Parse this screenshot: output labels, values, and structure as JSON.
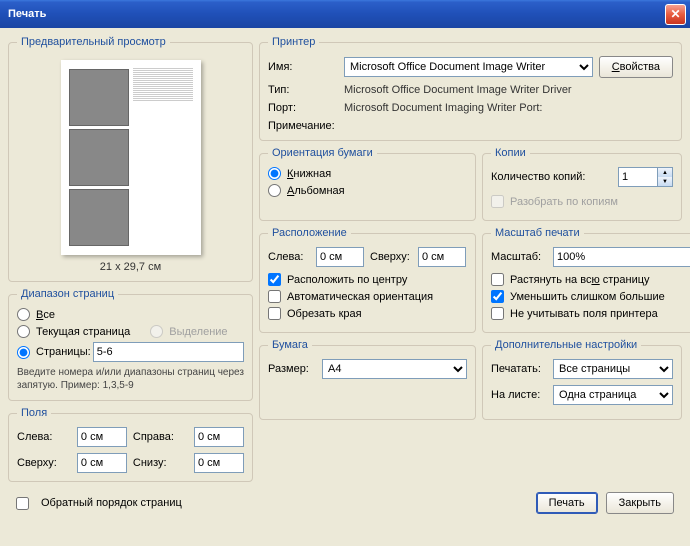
{
  "title": "Печать",
  "preview": {
    "legend": "Предварительный просмотр",
    "dimensions": "21 x 29,7 см"
  },
  "printer": {
    "legend": "Принтер",
    "name_label": "Имя:",
    "name_value": "Microsoft Office Document Image Writer",
    "props_btn": "Свойства",
    "type_label": "Тип:",
    "type_value": "Microsoft Office Document Image Writer Driver",
    "port_label": "Порт:",
    "port_value": "Microsoft Document Imaging Writer Port:",
    "note_label": "Примечание:",
    "note_value": ""
  },
  "orientation": {
    "legend": "Ориентация бумаги",
    "portrait": "Книжная",
    "landscape": "Альбомная"
  },
  "copies": {
    "legend": "Копии",
    "count_label": "Количество копий:",
    "count_value": "1",
    "collate": "Разобрать по копиям"
  },
  "range": {
    "legend": "Диапазон страниц",
    "all": "Все",
    "current": "Текущая страница",
    "selection": "Выделение",
    "pages": "Страницы:",
    "pages_value": "5-6",
    "hint": "Введите номера и/или диапазоны страниц через запятую. Пример: 1,3,5-9"
  },
  "layout": {
    "legend": "Расположение",
    "left_label": "Слева:",
    "left_value": "0 см",
    "top_label": "Сверху:",
    "top_value": "0 см",
    "center": "Расположить по центру",
    "auto_orient": "Автоматическая ориентация",
    "crop": "Обрезать края"
  },
  "scale": {
    "legend": "Масштаб печати",
    "scale_label": "Масштаб:",
    "scale_value": "100%",
    "stretch": "Растянуть на всю страницу",
    "shrink": "Уменьшить слишком большие",
    "ignore_margins": "Не учитывать поля принтера"
  },
  "margins": {
    "legend": "Поля",
    "left": "Слева:",
    "left_v": "0 см",
    "right": "Справа:",
    "right_v": "0 см",
    "top": "Сверху:",
    "top_v": "0 см",
    "bottom": "Снизу:",
    "bottom_v": "0 см"
  },
  "paper": {
    "legend": "Бумага",
    "size_label": "Размер:",
    "size_value": "A4"
  },
  "extra": {
    "legend": "Дополнительные настройки",
    "print_label": "Печатать:",
    "print_value": "Все страницы",
    "sheet_label": "На листе:",
    "sheet_value": "Одна страница"
  },
  "bottom": {
    "reverse": "Обратный порядок страниц",
    "print": "Печать",
    "close": "Закрыть"
  }
}
